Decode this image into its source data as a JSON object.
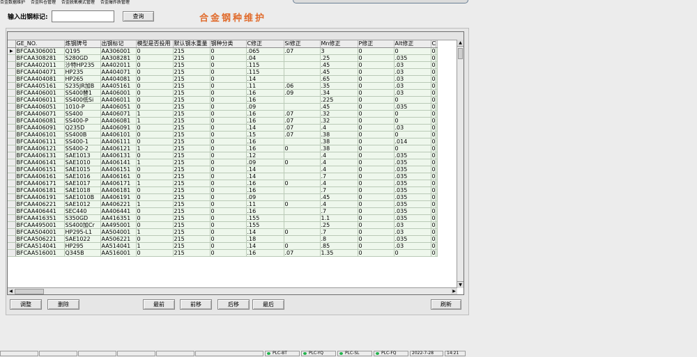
{
  "menu": [
    "合金数据维护",
    "合金料仓管理",
    "合金脱氧模式管理",
    "合金爆炸质管理"
  ],
  "search": {
    "label": "输入出钢标记:",
    "value": "",
    "button": "查询"
  },
  "title": "合金钢种维护",
  "table": {
    "columns": [
      "GE_NO.",
      "炼钢牌号",
      "出钢标记",
      "模型是否投用",
      "默认钢水重量",
      "钢种分类",
      "C修正",
      "Si修正",
      "Mn修正",
      "P修正",
      "Alt修正",
      "C"
    ],
    "rows": [
      [
        "BFCAA306001",
        "Q195",
        "AA306001",
        "0",
        "215",
        "0",
        ".065",
        ".07",
        "3",
        "0",
        "0",
        "0"
      ],
      [
        "BFCAA308281",
        "S280GD",
        "AA308281",
        "0",
        "215",
        "0",
        ".04",
        "",
        ".25",
        "0",
        ".035",
        "0"
      ],
      [
        "BFCAA402011",
        "沙特HP235",
        "AA402011",
        "0",
        "215",
        "0",
        ".115",
        "",
        ".45",
        "0",
        ".03",
        "0"
      ],
      [
        "BFCAA404071",
        "HP235",
        "AA404071",
        "0",
        "215",
        "0",
        ".115",
        "",
        ".45",
        "0",
        ".03",
        "0"
      ],
      [
        "BFCAA404081",
        "HP265",
        "AA404081",
        "0",
        "215",
        "0",
        ".14",
        "",
        ".65",
        "0",
        ".03",
        "0"
      ],
      [
        "BFCAA405161",
        "S235JR加B",
        "AA405161",
        "0",
        "215",
        "0",
        ".11",
        ".06",
        ".35",
        "0",
        ".03",
        "0"
      ],
      [
        "BFCAA406001",
        "SS400替1",
        "AA406001",
        "0",
        "215",
        "0",
        ".16",
        ".09",
        ".34",
        "0",
        ".03",
        "0"
      ],
      [
        "BFCAA406011",
        "SS400低Si",
        "AA406011",
        "0",
        "215",
        "0",
        ".16",
        "",
        ".225",
        "0",
        "0",
        "0"
      ],
      [
        "BFCAA406051",
        "1010-P",
        "AA406051",
        "0",
        "215",
        "0",
        ".09",
        "",
        ".45",
        "0",
        ".035",
        "0"
      ],
      [
        "BFCAA406071",
        "SS400",
        "AA406071",
        "1",
        "215",
        "0",
        ".16",
        ".07",
        ".32",
        "0",
        "0",
        "0"
      ],
      [
        "BFCAA406081",
        "SS400-P",
        "AA406081",
        "1",
        "215",
        "0",
        ".16",
        ".07",
        ".32",
        "0",
        "0",
        "0"
      ],
      [
        "BFCAA406091",
        "Q235D",
        "AA406091",
        "0",
        "215",
        "0",
        ".14",
        ".07",
        ".4",
        "0",
        ".03",
        "0"
      ],
      [
        "BFCAA406101",
        "SS400B",
        "AA406101",
        "0",
        "215",
        "0",
        ".15",
        ".07",
        ".38",
        "0",
        "0",
        "0"
      ],
      [
        "BFCAA406111",
        "SS400-1",
        "AA406111",
        "0",
        "215",
        "0",
        ".16",
        "",
        ".38",
        "0",
        ".014",
        "0"
      ],
      [
        "BFCAA406121",
        "SS400-2",
        "AA406121",
        "1",
        "215",
        "0",
        ".16",
        "0",
        ".38",
        "0",
        "0",
        "0"
      ],
      [
        "BFCAA406131",
        "SAE1013",
        "AA406131",
        "0",
        "215",
        "0",
        ".12",
        "",
        ".4",
        "0",
        ".035",
        "0"
      ],
      [
        "BFCAA406141",
        "SAE1010",
        "AA406141",
        "1",
        "215",
        "0",
        ".09",
        "0",
        ".4",
        "0",
        ".035",
        "0"
      ],
      [
        "BFCAA406151",
        "SAE1015",
        "AA406151",
        "0",
        "215",
        "0",
        ".14",
        "",
        ".4",
        "0",
        ".035",
        "0"
      ],
      [
        "BFCAA406161",
        "SAE1016",
        "AA406161",
        "0",
        "215",
        "0",
        ".14",
        "",
        ".7",
        "0",
        ".035",
        "0"
      ],
      [
        "BFCAA406171",
        "SAE1017",
        "AA406171",
        "1",
        "215",
        "0",
        ".16",
        "0",
        ".4",
        "0",
        ".035",
        "0"
      ],
      [
        "BFCAA406181",
        "SAE1018",
        "AA406181",
        "0",
        "215",
        "0",
        ".16",
        "",
        ".7",
        "0",
        ".035",
        "0"
      ],
      [
        "BFCAA406191",
        "SAE1010B",
        "AA406191",
        "0",
        "215",
        "0",
        ".09",
        "",
        ".45",
        "0",
        ".035",
        "0"
      ],
      [
        "BFCAA406221",
        "SAE1012",
        "AA406221",
        "1",
        "215",
        "0",
        ".11",
        "0",
        ".4",
        "0",
        ".035",
        "0"
      ],
      [
        "BFCAA406441",
        "SEC440",
        "AA406441",
        "0",
        "215",
        "0",
        ".16",
        "",
        ".7",
        "0",
        ".035",
        "0"
      ],
      [
        "BFCAA416351",
        "S350GD",
        "AA416351",
        "0",
        "215",
        "0",
        ".155",
        "",
        "1.1",
        "0",
        ".035",
        "0"
      ],
      [
        "BFCAA495001",
        "SS400加Cr",
        "AA495001",
        "0",
        "215",
        "0",
        ".155",
        "",
        ".25",
        "0",
        ".03",
        "0"
      ],
      [
        "BFCAA504001",
        "HP295-L1",
        "AA504001",
        "1",
        "215",
        "0",
        ".14",
        "0",
        ".7",
        "0",
        ".03",
        "0"
      ],
      [
        "BFCAA506221",
        "SAE1022",
        "AA506221",
        "0",
        "215",
        "0",
        ".18",
        "",
        ".8",
        "0",
        ".035",
        "0"
      ],
      [
        "BFCAA514041",
        "HP295",
        "AA514041",
        "1",
        "215",
        "0",
        ".14",
        "0",
        ".85",
        "0",
        ".03",
        "0"
      ],
      [
        "BFCAA516001",
        "Q345B",
        "AA516001",
        "0",
        "215",
        "0",
        ".16",
        ".07",
        "1.35",
        "0",
        "0",
        "0"
      ]
    ]
  },
  "buttons": {
    "adjust": "调整",
    "delete": "删除",
    "first": "最前",
    "prev": "前移",
    "next": "后移",
    "last": "最后",
    "refresh": "刷新"
  },
  "status": {
    "plc": [
      "PLC-BT",
      "PLC-YQ",
      "PLC-SL",
      "PLC-FQ"
    ],
    "date": "2022-7-28",
    "time": "14:21",
    "indicator_color": "#22b24c"
  },
  "colors": {
    "title": "#e06a2a",
    "row_bg": "#eef7ec"
  }
}
